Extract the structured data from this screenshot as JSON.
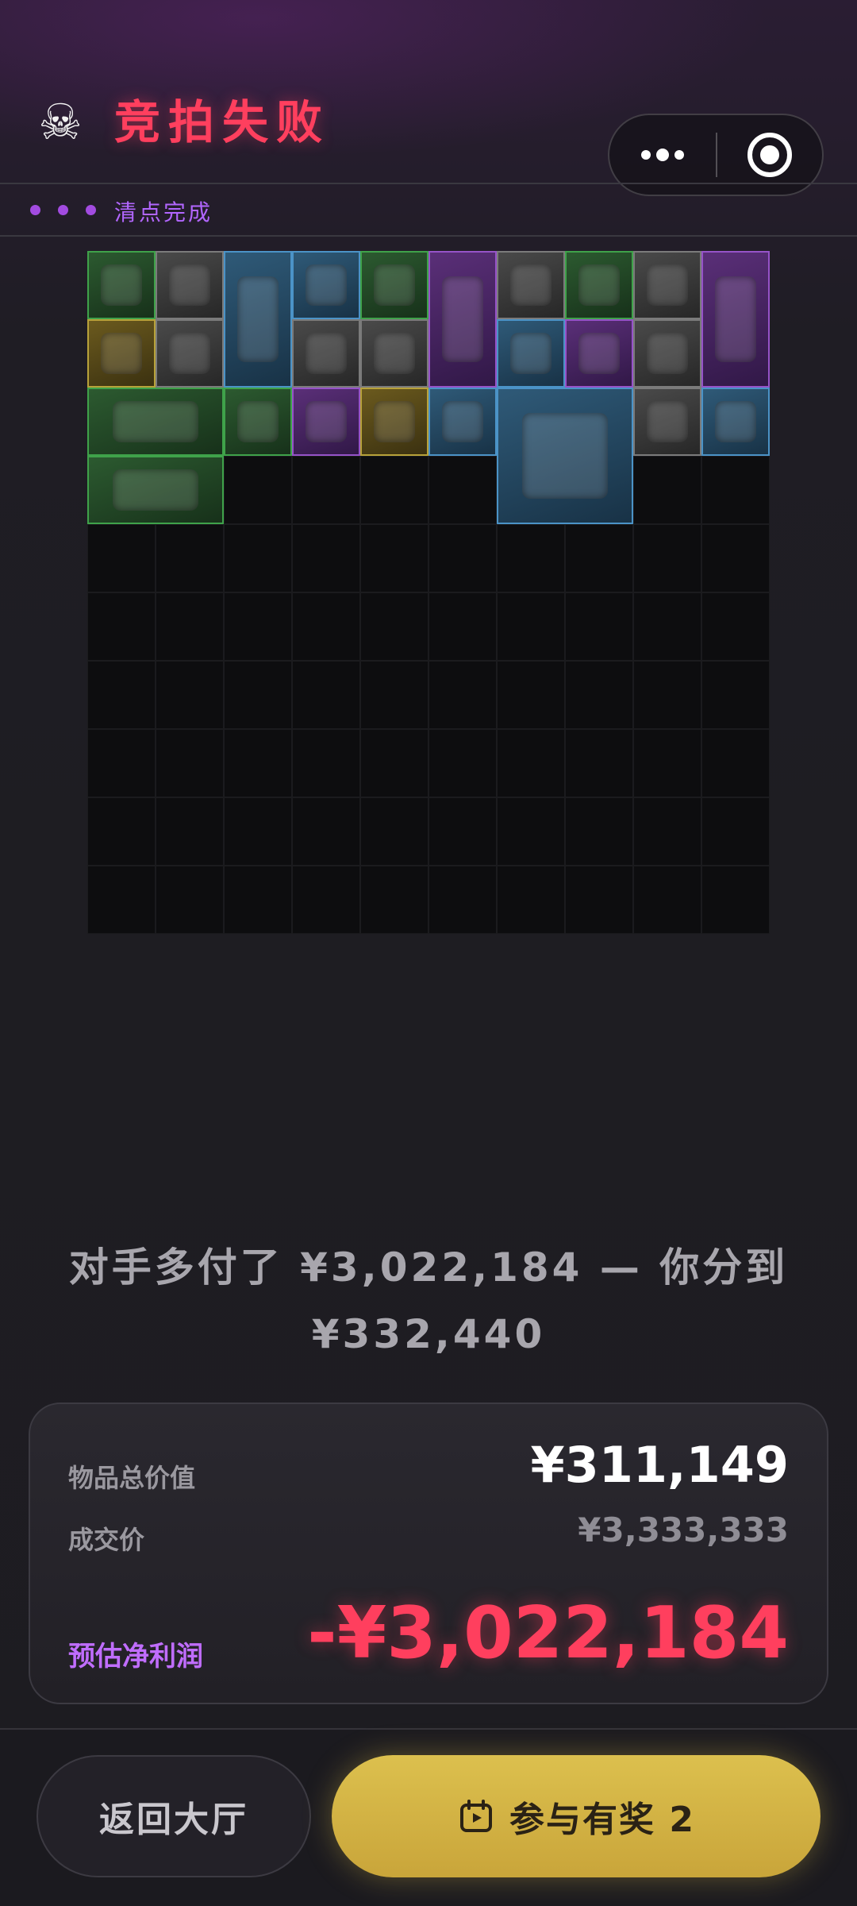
{
  "header": {
    "skull_icon": "☠",
    "title": "竞拍失败",
    "status_text": "清点完成"
  },
  "message": {
    "line1": "对手多付了 ¥3,022,184 — 你分到",
    "line2": "¥332,440"
  },
  "summary": {
    "total_value_label": "物品总价值",
    "total_value": "¥311,149",
    "deal_price_label": "成交价",
    "deal_price": "¥3,333,333",
    "profit_label": "预估净利润",
    "profit": "-¥3,022,184"
  },
  "buttons": {
    "back_label": "返回大厅",
    "join_label": "参与有奖 2"
  },
  "colors": {
    "accent_red": "#ff3f5e",
    "accent_purple": "#b266ff",
    "button_gold": "#d4b444"
  },
  "inventory": [
    {
      "name": "good-luck-card",
      "rarity": "green"
    },
    {
      "name": "computer-mouse",
      "rarity": "gray"
    },
    {
      "name": "stethoscope",
      "rarity": "blue"
    },
    {
      "name": "disc",
      "rarity": "blue"
    },
    {
      "name": "iv-bag",
      "rarity": "green"
    },
    {
      "name": "golden-ornament",
      "rarity": "purple"
    },
    {
      "name": "matchbox",
      "rarity": "gray"
    },
    {
      "name": "power-bank",
      "rarity": "green"
    },
    {
      "name": "rope",
      "rarity": "gray"
    },
    {
      "name": "old-pouch",
      "rarity": "purple"
    },
    {
      "name": "drone-part",
      "rarity": "gold"
    },
    {
      "name": "playing-card-clubs",
      "rarity": "gray"
    },
    {
      "name": "playing-card-hearts",
      "rarity": "gray"
    },
    {
      "name": "document-sheet",
      "rarity": "gray"
    },
    {
      "name": "cola-can",
      "rarity": "blue"
    },
    {
      "name": "energy-drink",
      "rarity": "purple"
    },
    {
      "name": "photo-card",
      "rarity": "gray"
    },
    {
      "name": "old-map",
      "rarity": "green"
    },
    {
      "name": "battery-9v",
      "rarity": "green"
    },
    {
      "name": "molecule-model",
      "rarity": "purple"
    },
    {
      "name": "gas-canister",
      "rarity": "gold"
    },
    {
      "name": "disc-2",
      "rarity": "blue"
    },
    {
      "name": "camping-stove",
      "rarity": "blue"
    },
    {
      "name": "playing-card-diamonds",
      "rarity": "gray"
    },
    {
      "name": "cigarette-pack",
      "rarity": "blue"
    },
    {
      "name": "keyboard",
      "rarity": "green"
    }
  ]
}
